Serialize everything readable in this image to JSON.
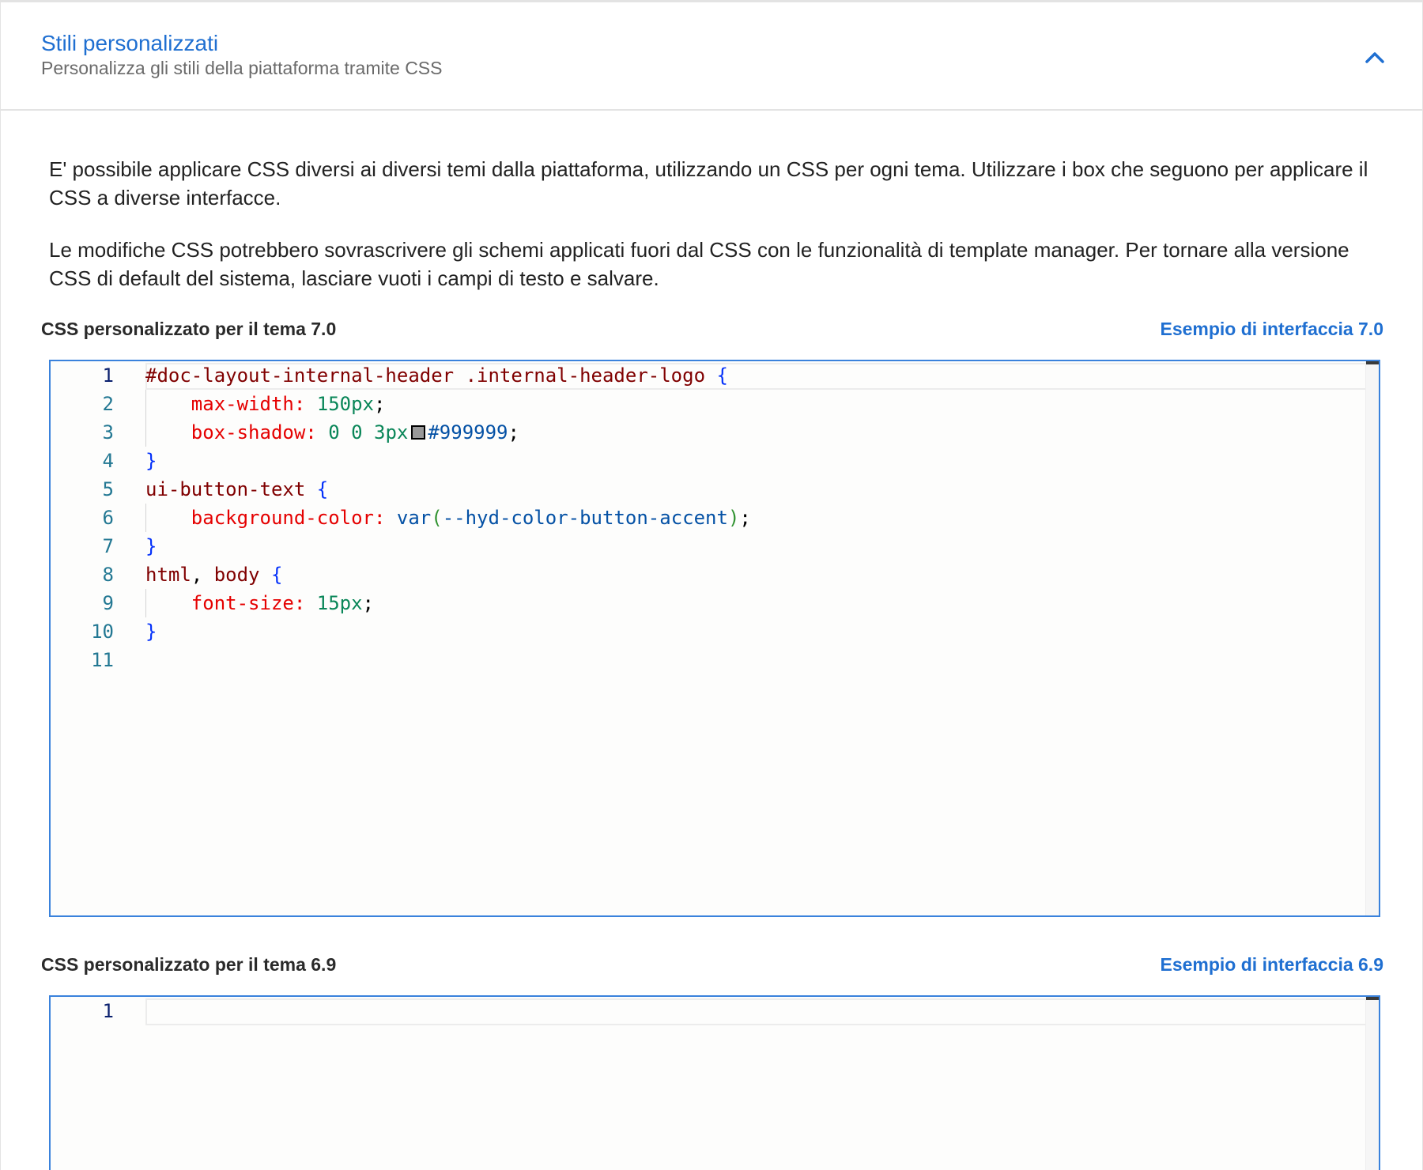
{
  "header": {
    "title": "Stili personalizzati",
    "subtitle": "Personalizza gli stili della piattaforma tramite CSS",
    "collapse_icon": "chevron-up-icon"
  },
  "description": {
    "paragraph1": "E' possibile applicare CSS diversi ai diversi temi dalla piattaforma, utilizzando un CSS per ogni tema. Utilizzare i box che seguono per applicare il CSS a diverse interfacce.",
    "paragraph2": "Le modifiche CSS potrebbero sovrascrivere gli schemi applicati fuori dal CSS con le funzionalità di template manager. Per tornare alla versione CSS di default del sistema, lasciare vuoti i campi di testo e salvare."
  },
  "sections": [
    {
      "label": "CSS personalizzato per il tema 7.0",
      "link": "Esempio di interfaccia 7.0",
      "line_numbers": [
        "1",
        "2",
        "3",
        "4",
        "5",
        "6",
        "7",
        "8",
        "9",
        "10",
        "11"
      ],
      "code": {
        "l1_selector": "#doc-layout-internal-header .internal-header-logo",
        "l2_prop": "max-width:",
        "l2_value": "150px",
        "l3_prop": "box-shadow:",
        "l3_value": "0 0 3px",
        "l3_color": "#999999",
        "l5_selector": "ui-button-text",
        "l6_prop": "background-color:",
        "l6_func": "var",
        "l6_arg": "--hyd-color-button-accent",
        "l8_selector_a": "html",
        "l8_selector_b": "body",
        "l9_prop": "font-size:",
        "l9_value": "15px",
        "open_brace": "{",
        "close_brace": "}",
        "semicolon": ";",
        "comma": ",",
        "paren_open": "(",
        "paren_close": ")"
      }
    },
    {
      "label": "CSS personalizzato per il tema 6.9",
      "link": "Esempio di interfaccia 6.9",
      "line_numbers": [
        "1"
      ]
    }
  ],
  "colors": {
    "accent": "#1f6fd1",
    "editor_border": "#3a82dc",
    "selector": "#800000",
    "property": "#e50000",
    "number": "#098658",
    "value": "#0451a5",
    "brace": "#0431fa"
  }
}
